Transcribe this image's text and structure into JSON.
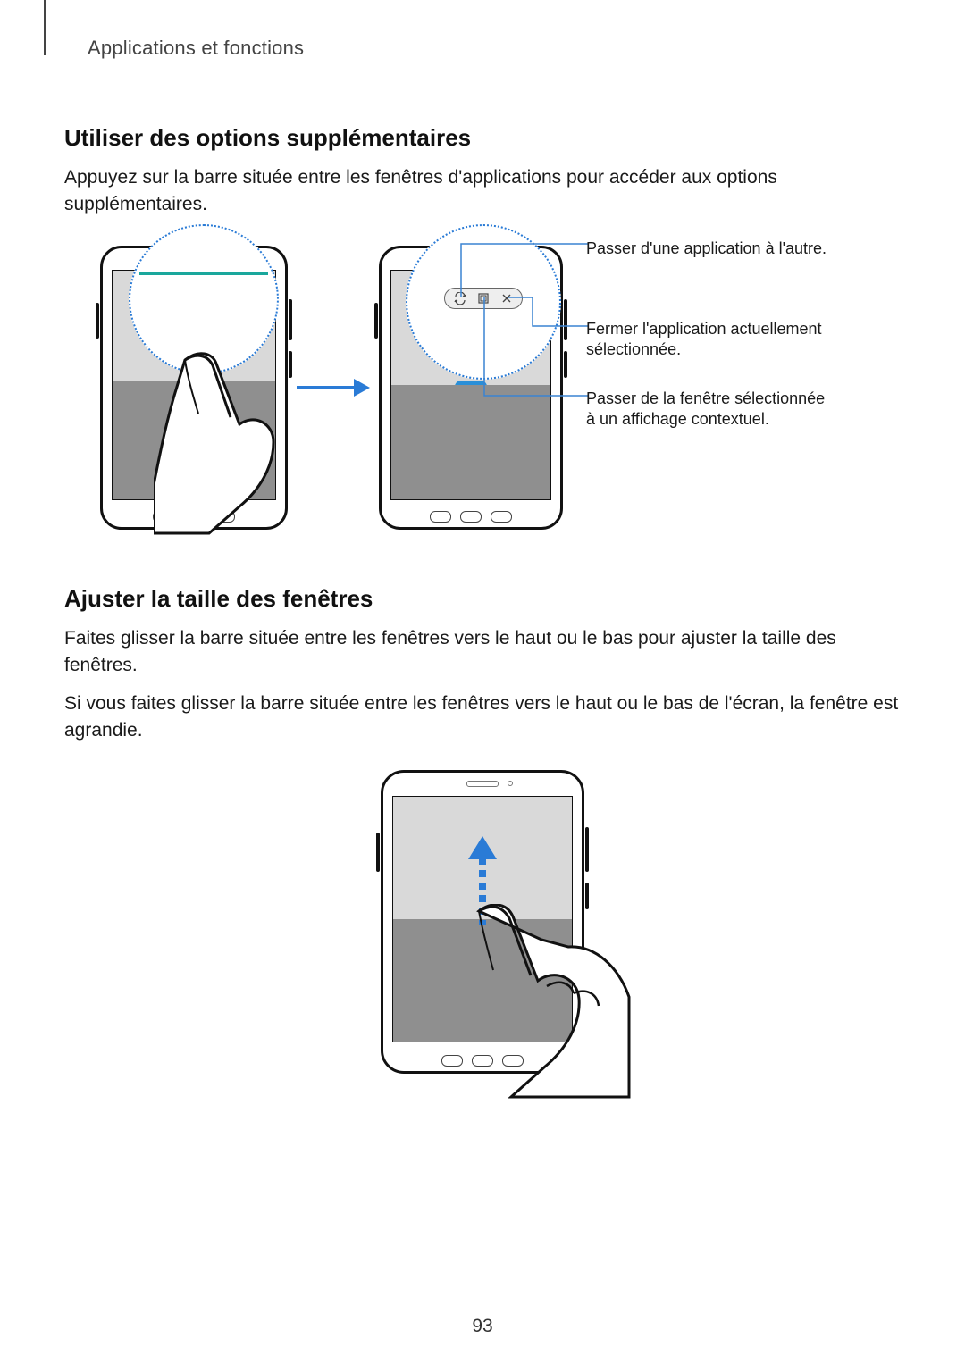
{
  "header": {
    "breadcrumb": "Applications et fonctions"
  },
  "section1": {
    "heading": "Utiliser des options supplémentaires",
    "para": "Appuyez sur la barre située entre les fenêtres d'applications pour accéder aux options supplémentaires."
  },
  "callouts": {
    "swap": "Passer d'une application à l'autre.",
    "close": "Fermer l'application actuellement sélectionnée.",
    "popup": "Passer de la fenêtre sélectionnée à un affichage contextuel."
  },
  "pill_icons": {
    "swap": "swap-icon",
    "popup": "popup-view-icon",
    "close": "close-icon"
  },
  "section2": {
    "heading": "Ajuster la taille des fenêtres",
    "para1": "Faites glisser la barre située entre les fenêtres vers le haut ou le bas pour ajuster la taille des fenêtres.",
    "para2": "Si vous faites glisser la barre située entre les fenêtres vers le haut ou le bas de l'écran, la fenêtre est agrandie."
  },
  "colors": {
    "accent_teal": "#1aa79c",
    "accent_blue": "#2a7bd6"
  },
  "page_number": "93"
}
